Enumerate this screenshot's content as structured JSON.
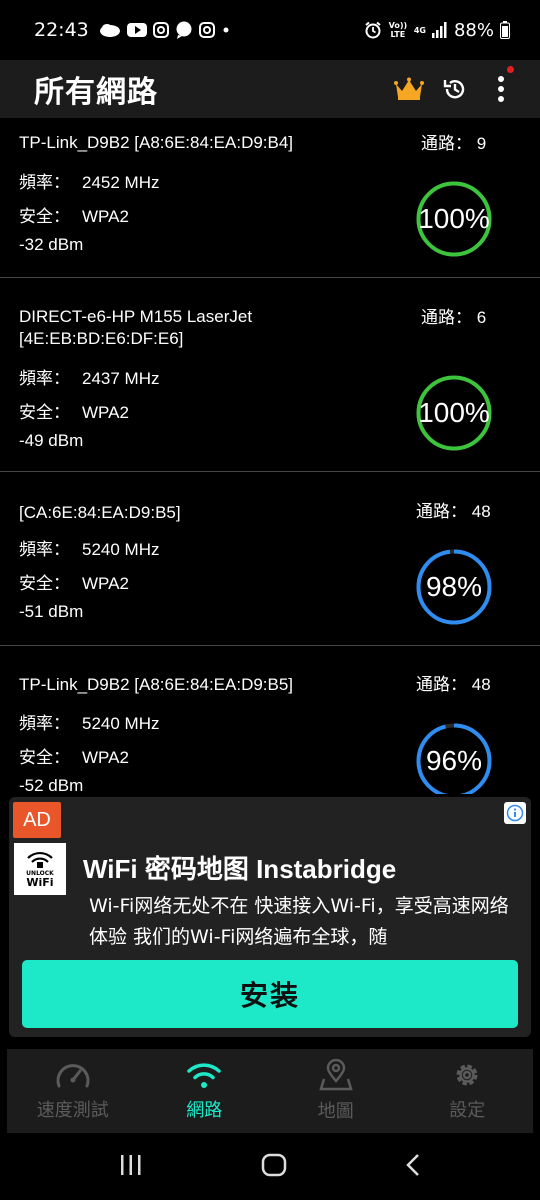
{
  "status_bar": {
    "time": "22:43",
    "volte": "Vo)) LTE",
    "network": "4G",
    "battery": "88%"
  },
  "app_bar": {
    "title": "所有網路"
  },
  "networks": [
    {
      "ssid": "TP-Link_D9B2 [A8:6E:84:EA:D9:B4]",
      "channel_label": "通路：",
      "channel": "9",
      "freq_label": "頻率：",
      "freq": "2452 MHz",
      "security_label": "安全：",
      "security": "WPA2",
      "signal": "-32 dBm",
      "quality": "100%",
      "quality_value": 1.0,
      "ring_color": "#3cc43c"
    },
    {
      "ssid": "DIRECT-e6-HP M155 LaserJet [4E:EB:BD:E6:DF:E6]",
      "channel_label": "通路：",
      "channel": "6",
      "freq_label": "頻率：",
      "freq": "2437 MHz",
      "security_label": "安全：",
      "security": "WPA2",
      "signal": "-49 dBm",
      "quality": "100%",
      "quality_value": 1.0,
      "ring_color": "#3cc43c"
    },
    {
      "ssid": " [CA:6E:84:EA:D9:B5]",
      "channel_label": "通路：",
      "channel": "48",
      "freq_label": "頻率：",
      "freq": "5240 MHz",
      "security_label": "安全：",
      "security": "WPA2",
      "signal": "-51 dBm",
      "quality": "98%",
      "quality_value": 0.98,
      "ring_color": "#2f8cf0"
    },
    {
      "ssid": "TP-Link_D9B2 [A8:6E:84:EA:D9:B5]",
      "channel_label": "通路：",
      "channel": "48",
      "freq_label": "頻率：",
      "freq": "5240 MHz",
      "security_label": "安全：",
      "security": "WPA2",
      "signal": "-52 dBm",
      "quality": "96%",
      "quality_value": 0.96,
      "ring_color": "#2f8cf0"
    }
  ],
  "ad": {
    "badge": "AD",
    "logo_line1": "UNLOCK",
    "logo_line2": "WiFi",
    "headline": "WiFi 密码地图 Instabridge",
    "body": "Wi-Fi网络无处不在 快速接入Wi-Fi，享受高速网络体验 我们的Wi-Fi网络遍布全球，随",
    "install": "安装"
  },
  "bottom_nav": [
    {
      "label": "速度測試",
      "icon": "speedometer-icon"
    },
    {
      "label": "網路",
      "icon": "wifi-icon",
      "active": true
    },
    {
      "label": "地圖",
      "icon": "map-pin-icon"
    },
    {
      "label": "設定",
      "icon": "gear-icon"
    }
  ],
  "colors": {
    "accent": "#1de9c8",
    "crown": "#f5a623",
    "ad_badge": "#e8562a"
  }
}
